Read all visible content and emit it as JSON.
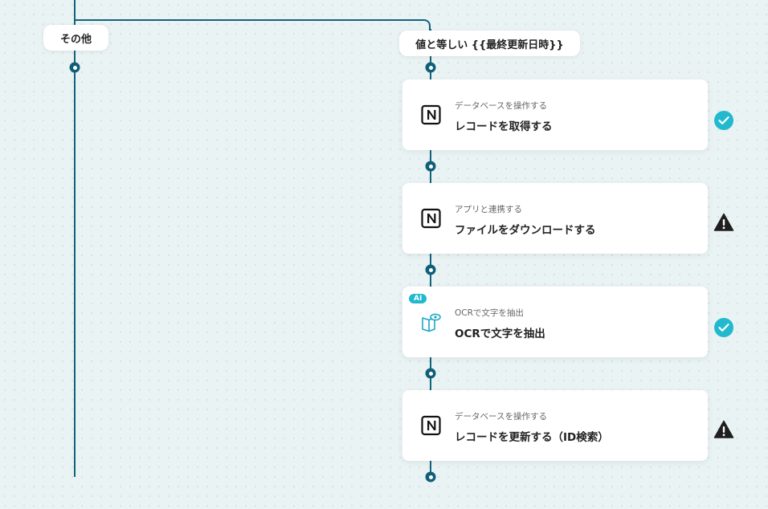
{
  "branches": {
    "else_label": "その他",
    "condition_label": "値と等しい {{最終更新日時}}"
  },
  "steps": [
    {
      "ai": false,
      "app_icon": "notion-icon",
      "category": "データベースを操作する",
      "title": "レコードを取得する",
      "status": "success"
    },
    {
      "ai": false,
      "app_icon": "notion-icon",
      "category": "アプリと連携する",
      "title": "ファイルをダウンロードする",
      "status": "warning"
    },
    {
      "ai": true,
      "ai_label": "AI",
      "app_icon": "ocr-book-eye-icon",
      "category": "OCRで文字を抽出",
      "title": "OCRで文字を抽出",
      "status": "success"
    },
    {
      "ai": false,
      "app_icon": "notion-icon",
      "category": "データベースを操作する",
      "title": "レコードを更新する（ID検索）",
      "status": "warning"
    }
  ],
  "colors": {
    "connector": "#12627a",
    "success": "#22b9cf",
    "warning": "#1f1f1f",
    "background": "#eaf3f4"
  }
}
